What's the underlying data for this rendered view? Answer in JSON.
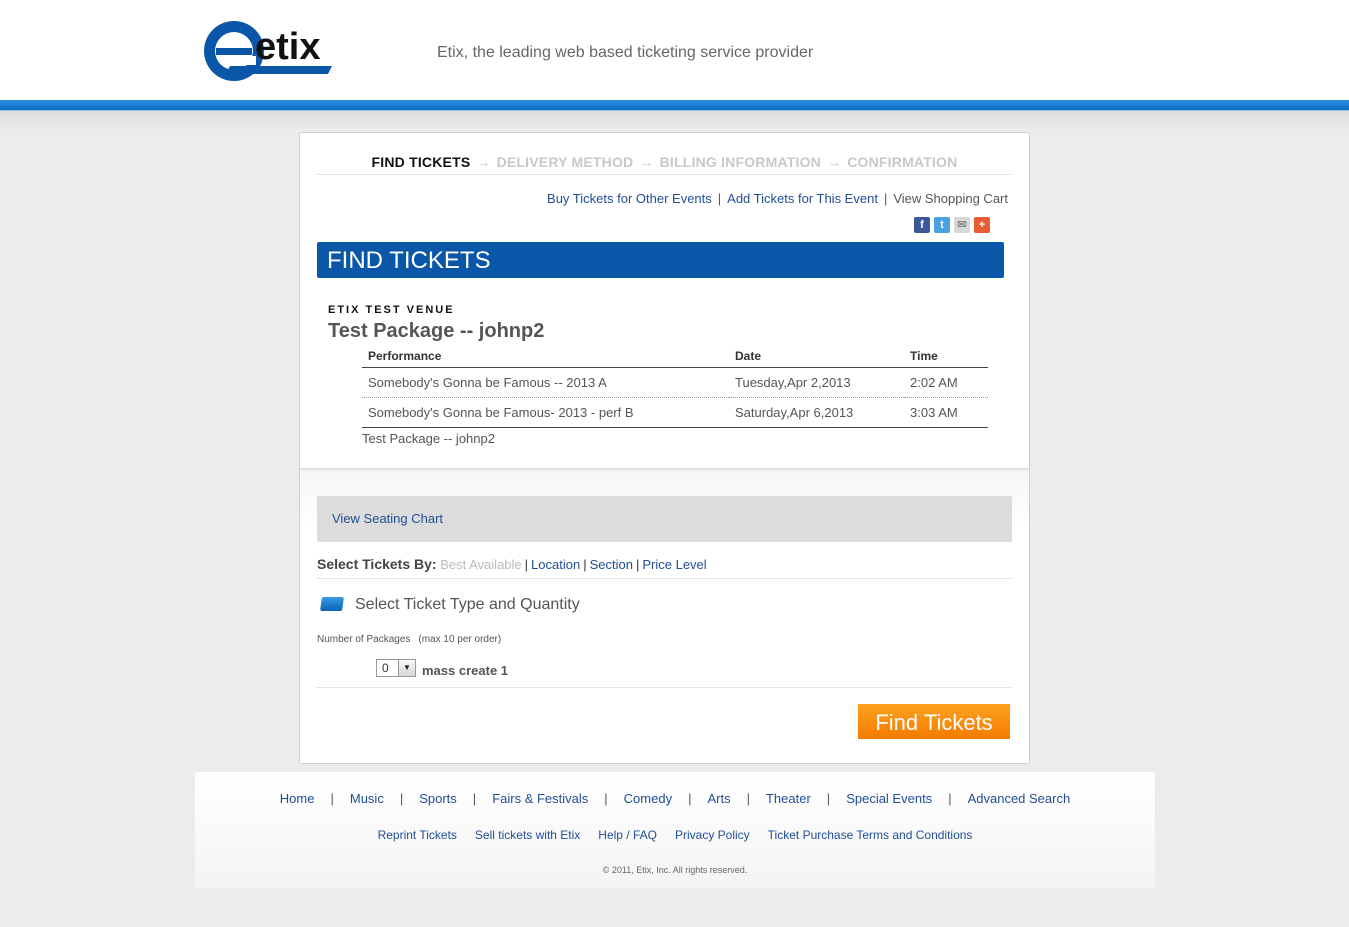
{
  "header": {
    "tagline": "Etix, the leading web based ticketing service provider",
    "logo_text": "etix"
  },
  "steps": {
    "items": [
      "FIND TICKETS",
      "DELIVERY METHOD",
      "BILLING INFORMATION",
      "CONFIRMATION"
    ],
    "arrow": "→"
  },
  "toplinks": {
    "buy_other": "Buy Tickets for Other Events",
    "add_this": "Add Tickets for This Event",
    "view_cart": "View Shopping Cart",
    "sep": "|"
  },
  "share": {
    "facebook": "f",
    "twitter": "t",
    "email": "✉",
    "more": "+"
  },
  "section_title": "FIND TICKETS",
  "venue": "ETIX TEST VENUE",
  "package_title": "Test Package -- johnp2",
  "performances": {
    "headers": {
      "performance": "Performance",
      "date": "Date",
      "time": "Time"
    },
    "rows": [
      {
        "performance": "Somebody's Gonna be Famous -- 2013 A",
        "date": "Tuesday,Apr 2,2013",
        "time": "2:02 AM"
      },
      {
        "performance": "Somebody's Gonna be Famous- 2013 - perf B",
        "date": "Saturday,Apr 6,2013",
        "time": "3:03 AM"
      }
    ],
    "footer": "Test Package -- johnp2"
  },
  "seating": {
    "link": "View Seating Chart"
  },
  "select_by": {
    "label": "Select Tickets By:",
    "options": [
      "Best Available",
      "Location",
      "Section",
      "Price Level"
    ],
    "sep": "|"
  },
  "ticket_type": {
    "title": "Select Ticket Type and Quantity",
    "num_label": "Number of Packages",
    "num_sub": "(max 10 per order)",
    "qty_value": "0",
    "qty_arrow": "▼",
    "item_name": "mass create 1"
  },
  "find_button": "Find Tickets",
  "footer": {
    "nav": [
      "Home",
      "Music",
      "Sports",
      "Fairs & Festivals",
      "Comedy",
      "Arts",
      "Theater",
      "Special Events",
      "Advanced Search"
    ],
    "sep": "|",
    "links": [
      "Reprint Tickets",
      "Sell tickets with Etix",
      "Help / FAQ",
      "Privacy Policy",
      "Ticket Purchase Terms and Conditions"
    ],
    "copyright": "© 2011, Etix, Inc. All rights reserved."
  },
  "colors": {
    "brand_blue": "#0a56a8",
    "header_bar": "#1a7fd4",
    "button_orange": "#f98a0a",
    "link": "#1f4e96"
  }
}
